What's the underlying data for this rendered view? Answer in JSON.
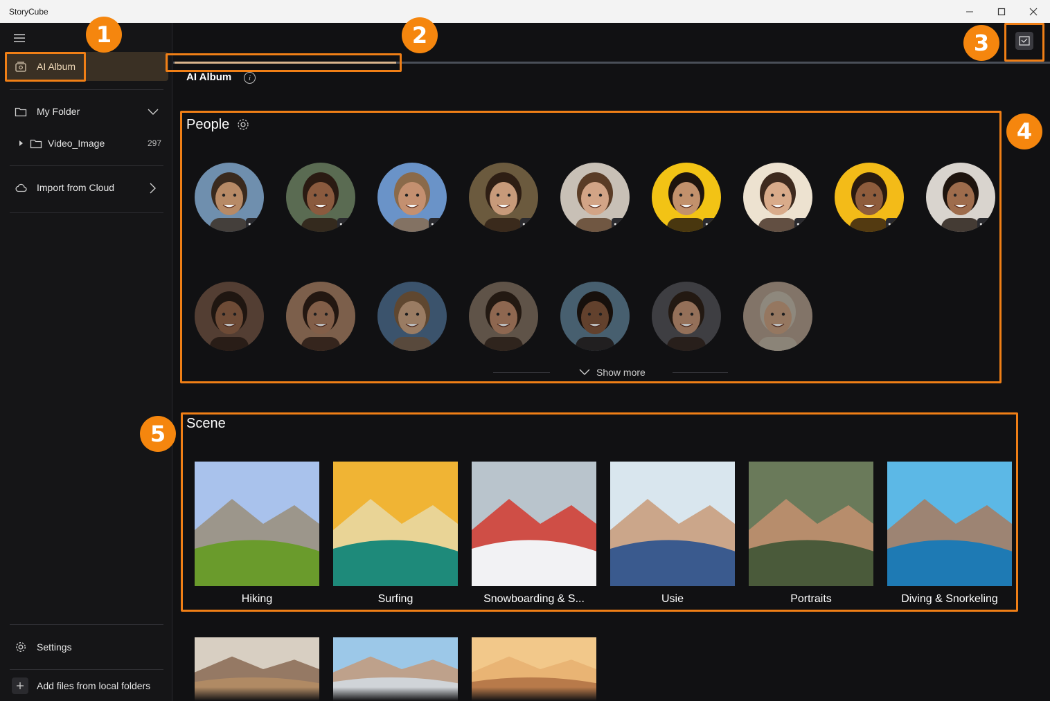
{
  "window": {
    "title": "StoryCube"
  },
  "sidebar": {
    "ai_album": "AI Album",
    "my_folder": "My Folder",
    "folder_child": {
      "name": "Video_Image",
      "count": "297"
    },
    "import_cloud": "Import from Cloud",
    "settings": "Settings",
    "add_files": "Add files from local folders"
  },
  "main": {
    "header_title": "AI Album",
    "progress": 0.5,
    "people_title": "People",
    "show_more": "Show more",
    "scene_title": "Scene",
    "more_label": "•••"
  },
  "people": [
    {
      "skin": "#b78a66",
      "hair": "#3a2a1e",
      "bg": "#6f8fae"
    },
    {
      "skin": "#8a5a3e",
      "hair": "#2a1a12",
      "bg": "#5a6b52"
    },
    {
      "skin": "#c49070",
      "hair": "#8a6a4a",
      "bg": "#6a93c8"
    },
    {
      "skin": "#c79a7a",
      "hair": "#2e1e14",
      "bg": "#6b5a3e"
    },
    {
      "skin": "#d2a486",
      "hair": "#5a3c26",
      "bg": "#c8c0b6"
    },
    {
      "skin": "#c2916c",
      "hair": "#1e140e",
      "bg": "#f2c315"
    },
    {
      "skin": "#d9ab8a",
      "hair": "#3e2a1e",
      "bg": "#ede2d0"
    },
    {
      "skin": "#8e5c3c",
      "hair": "#2a1a10",
      "bg": "#f3bb18"
    },
    {
      "skin": "#9e6c4c",
      "hair": "#1e140e",
      "bg": "#d9d4ce"
    },
    {
      "skin": "#8e5f42",
      "hair": "#241810",
      "bg": "#6a4e3e"
    },
    {
      "skin": "#a8785a",
      "hair": "#2a1a10",
      "bg": "#a07a5e"
    },
    {
      "skin": "#c9a07e",
      "hair": "#7a5a3a",
      "bg": "#4a6a8a"
    },
    {
      "skin": "#b88564",
      "hair": "#2a1c12",
      "bg": "#7a6a5a"
    },
    {
      "skin": "#7e5236",
      "hair": "#1a100a",
      "bg": "#5a7a8e"
    },
    {
      "skin": "#c09070",
      "hair": "#2a1c12",
      "bg": "#4e4e52"
    },
    {
      "skin": "#c29a7a",
      "hair": "#b8b0a0",
      "bg": "#a89684"
    }
  ],
  "scenes": [
    {
      "label": "Hiking",
      "sky": "#a9c2ec",
      "ground": "#6a9b2c",
      "mid": "#9a8e7a"
    },
    {
      "label": "Surfing",
      "sky": "#f0b434",
      "ground": "#1e8a7a",
      "mid": "#e8d9a8"
    },
    {
      "label": "Snowboarding & S...",
      "sky": "#b9c4cc",
      "ground": "#f2f2f4",
      "mid": "#d23a2e"
    },
    {
      "label": "Usie",
      "sky": "#d9e6ee",
      "ground": "#3a5a8e",
      "mid": "#c89a78"
    },
    {
      "label": "Portraits",
      "sky": "#6a7a5a",
      "ground": "#4a5a3a",
      "mid": "#c49070"
    },
    {
      "label": "Diving & Snorkeling",
      "sky": "#5cb8e6",
      "ground": "#1e7ab4",
      "mid": "#a87a5e"
    }
  ],
  "scenes_more": [
    {
      "sky": "#d8cfc2",
      "ground": "#b08a64",
      "mid": "#8a6a54"
    },
    {
      "sky": "#9cc8e8",
      "ground": "#d0d4d8",
      "mid": "#c49a7a"
    },
    {
      "sky": "#f2c88a",
      "ground": "#b87a4a",
      "mid": "#e8b070"
    }
  ],
  "colors": {
    "accent": "#f07f16",
    "badge": "#f5860e",
    "selected": "#3a3024"
  }
}
